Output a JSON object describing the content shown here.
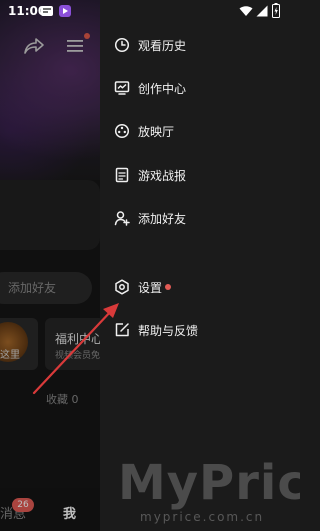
{
  "status_bar": {
    "time": "11:00",
    "icons": [
      "notification-icon",
      "app-icon",
      "wifi-icon",
      "signal-icon",
      "battery-icon"
    ]
  },
  "background_app": {
    "search_placeholder": "添加好友",
    "tile1_text": "这里",
    "tile2_title": "福利中心",
    "tile2_sub": "视频会员免",
    "favorites": "收藏 0",
    "nav": {
      "messages_label": "消息",
      "messages_badge": "26",
      "me_label": "我"
    }
  },
  "drawer": {
    "items": [
      {
        "label": "观看历史",
        "icon": "clock-icon"
      },
      {
        "label": "创作中心",
        "icon": "creator-icon"
      },
      {
        "label": "放映厅",
        "icon": "film-reel-icon"
      },
      {
        "label": "游戏战报",
        "icon": "document-icon"
      },
      {
        "label": "添加好友",
        "icon": "add-user-icon"
      },
      {
        "label": "设置",
        "icon": "settings-icon",
        "badge_dot": true
      },
      {
        "label": "帮助与反馈",
        "icon": "edit-feedback-icon"
      }
    ]
  },
  "annotation": {
    "color": "#d93a3a"
  },
  "watermark": {
    "main": "MyPrice",
    "sub": "myprice.com.cn"
  },
  "colors": {
    "badge": "#e25b55",
    "drawer_bg": "#1b1b1b"
  }
}
